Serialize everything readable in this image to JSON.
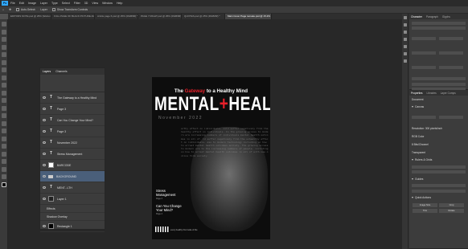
{
  "app": {
    "logo": "Ps"
  },
  "menu": [
    "File",
    "Edit",
    "Image",
    "Layer",
    "Type",
    "Select",
    "Filter",
    "3D",
    "View",
    "Window",
    "Help"
  ],
  "options_bar": {
    "auto_select_label": "Auto-Select:",
    "auto_select_value": "Layer",
    "show_transform_label": "Show Transform Controls"
  },
  "tabs": [
    {
      "label": "EDITORS NOTE.psd @ 25% (Welcome to my latest m...",
      "active": false
    },
    {
      "label": "FULL PAGE OF BLACK PICTURE ARTICLE.psd @ 25% (...",
      "active": false
    },
    {
      "label": "Article page 6.psd @ 25% (RGB/8#) *",
      "active": false
    },
    {
      "label": "PAGE 7 RIGHT.psd @ 25% (RGB/8#) *",
      "active": false
    },
    {
      "label": "QUOTES.psd @ 25% (RGB/8#) *",
      "active": false
    },
    {
      "label": "Main Cover Page remake.psd @ 15.2% (RGB/8) *",
      "active": true
    }
  ],
  "layers_panel": {
    "tabs": [
      "Layers",
      "Channels"
    ],
    "rows": [
      {
        "label": "The Gateway to a Healthy Mind",
        "type": "text",
        "selected": false
      },
      {
        "label": "Page 3",
        "type": "text",
        "selected": false
      },
      {
        "label": "Can You Change Your Mind?",
        "type": "text",
        "selected": false
      },
      {
        "label": "Page 3",
        "type": "text",
        "selected": false
      },
      {
        "label": "November 2022",
        "type": "text",
        "selected": false
      },
      {
        "label": "Stress Management",
        "type": "text",
        "selected": false
      },
      {
        "label": "BARCODE",
        "type": "image",
        "selected": false
      },
      {
        "label": "BACKGROUND",
        "type": "group",
        "selected": true
      },
      {
        "label": "MENT...LTH",
        "type": "text",
        "selected": false
      },
      {
        "label": "Layer 1",
        "type": "image",
        "selected": false
      },
      {
        "label": "Effects",
        "type": "sub",
        "selected": false
      },
      {
        "label": "Shadow Overlay",
        "type": "sub",
        "selected": false
      },
      {
        "label": "Rectangle 1",
        "type": "image",
        "selected": false
      }
    ]
  },
  "cover": {
    "tagline_pre": "The ",
    "tagline_red": "Gateway",
    "tagline_post": " to a Healthy Mind",
    "masthead_a": "MENTAL",
    "masthead_plus": "+",
    "masthead_b": "HEALTH",
    "issue": "November 2022",
    "item1_title": "Stress Management",
    "item1_page": "Page 3",
    "item2_title": "Can You Change Your Mind?",
    "item2_page": "Page 4",
    "barcode_text": "every healthy first mode of the",
    "pattern_text": "arthy effect on individuals. ould suffer negatively from the healthy effect on individuals. In the growing access to modern era increasing numbers of individuals mental health outcomes in all of. ld suffer negatively from the unhealthy effect on individuals. ess to modern technology including on how to arrest mental health outcomes anxiety. The growing access to modern era to the increasing numbers of people. including on how to arrest mental health outcomes in all of with new online form society."
  },
  "right_panels": {
    "character_tabs": [
      "Character",
      "Paragraph",
      "Glyphs"
    ],
    "properties_tabs": [
      "Properties",
      "Libraries",
      "Layer Comps"
    ],
    "properties_doc": "Document",
    "canvas_section": "Canvas",
    "rulers_section": "Rulers & Grids",
    "guides_section": "Guides",
    "quick_actions_section": "Quick Actions",
    "quick_actions": [
      "Image Size",
      "Crop",
      "Trim",
      "Rotate"
    ],
    "resolution": "Resolution: 300 pixels/inch",
    "mode": "RGB Color",
    "bits": "8 Bits/Channel",
    "fill": "Transparent"
  }
}
